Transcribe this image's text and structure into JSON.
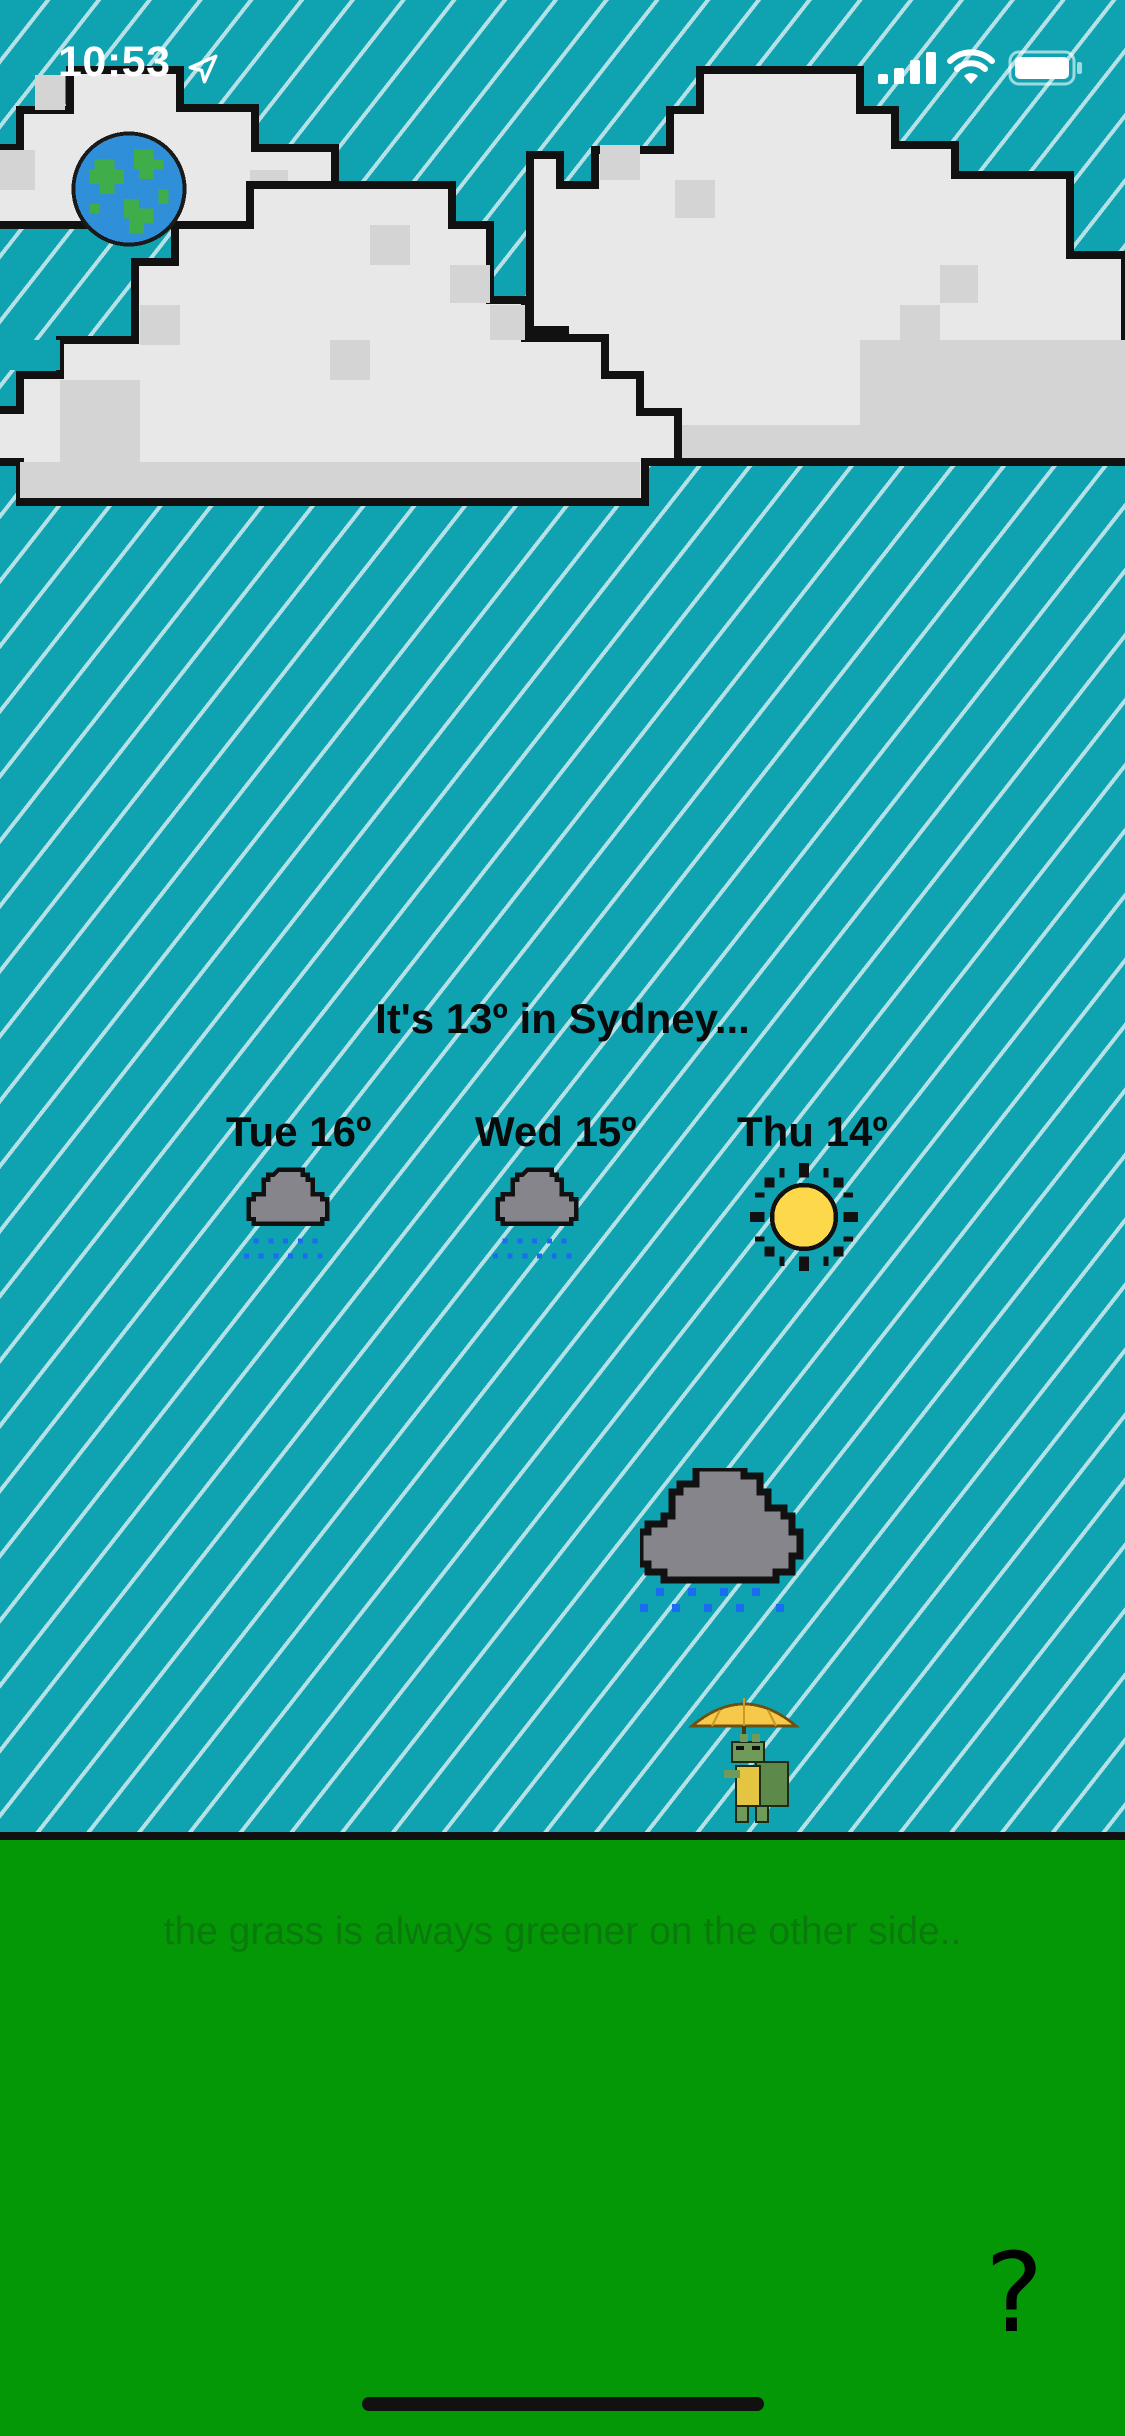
{
  "status_bar": {
    "time": "10:53",
    "location_icon": "location-arrow-icon",
    "signal_icon": "cellular-signal-icon",
    "wifi_icon": "wifi-icon",
    "battery_icon": "battery-icon"
  },
  "colors": {
    "sky": "#0fa2b1",
    "rain_streak": "#ebf6f8",
    "cloud_light": "#e8e8e8",
    "cloud_shade": "#d4d4d4",
    "storm_cloud": "#87858c",
    "rain_drop": "#1a6cf0",
    "sun": "#fdd84a",
    "grass": "#049806",
    "text": "#0a0a0a"
  },
  "globe": {
    "icon": "earth-globe-icon"
  },
  "current": {
    "headline": "It's 13º in Sydney..."
  },
  "forecast": [
    {
      "label": "Tue 16º",
      "icon": "rain-cloud-icon"
    },
    {
      "label": "Wed 15º",
      "icon": "rain-cloud-icon"
    },
    {
      "label": "Thu 14º",
      "icon": "sun-icon"
    }
  ],
  "scene": {
    "cloud_icon": "storm-cloud-icon",
    "character_icon": "turtle-with-umbrella-icon"
  },
  "ground": {
    "tagline": "the grass is always greener on the other side..",
    "help_label": "?"
  }
}
